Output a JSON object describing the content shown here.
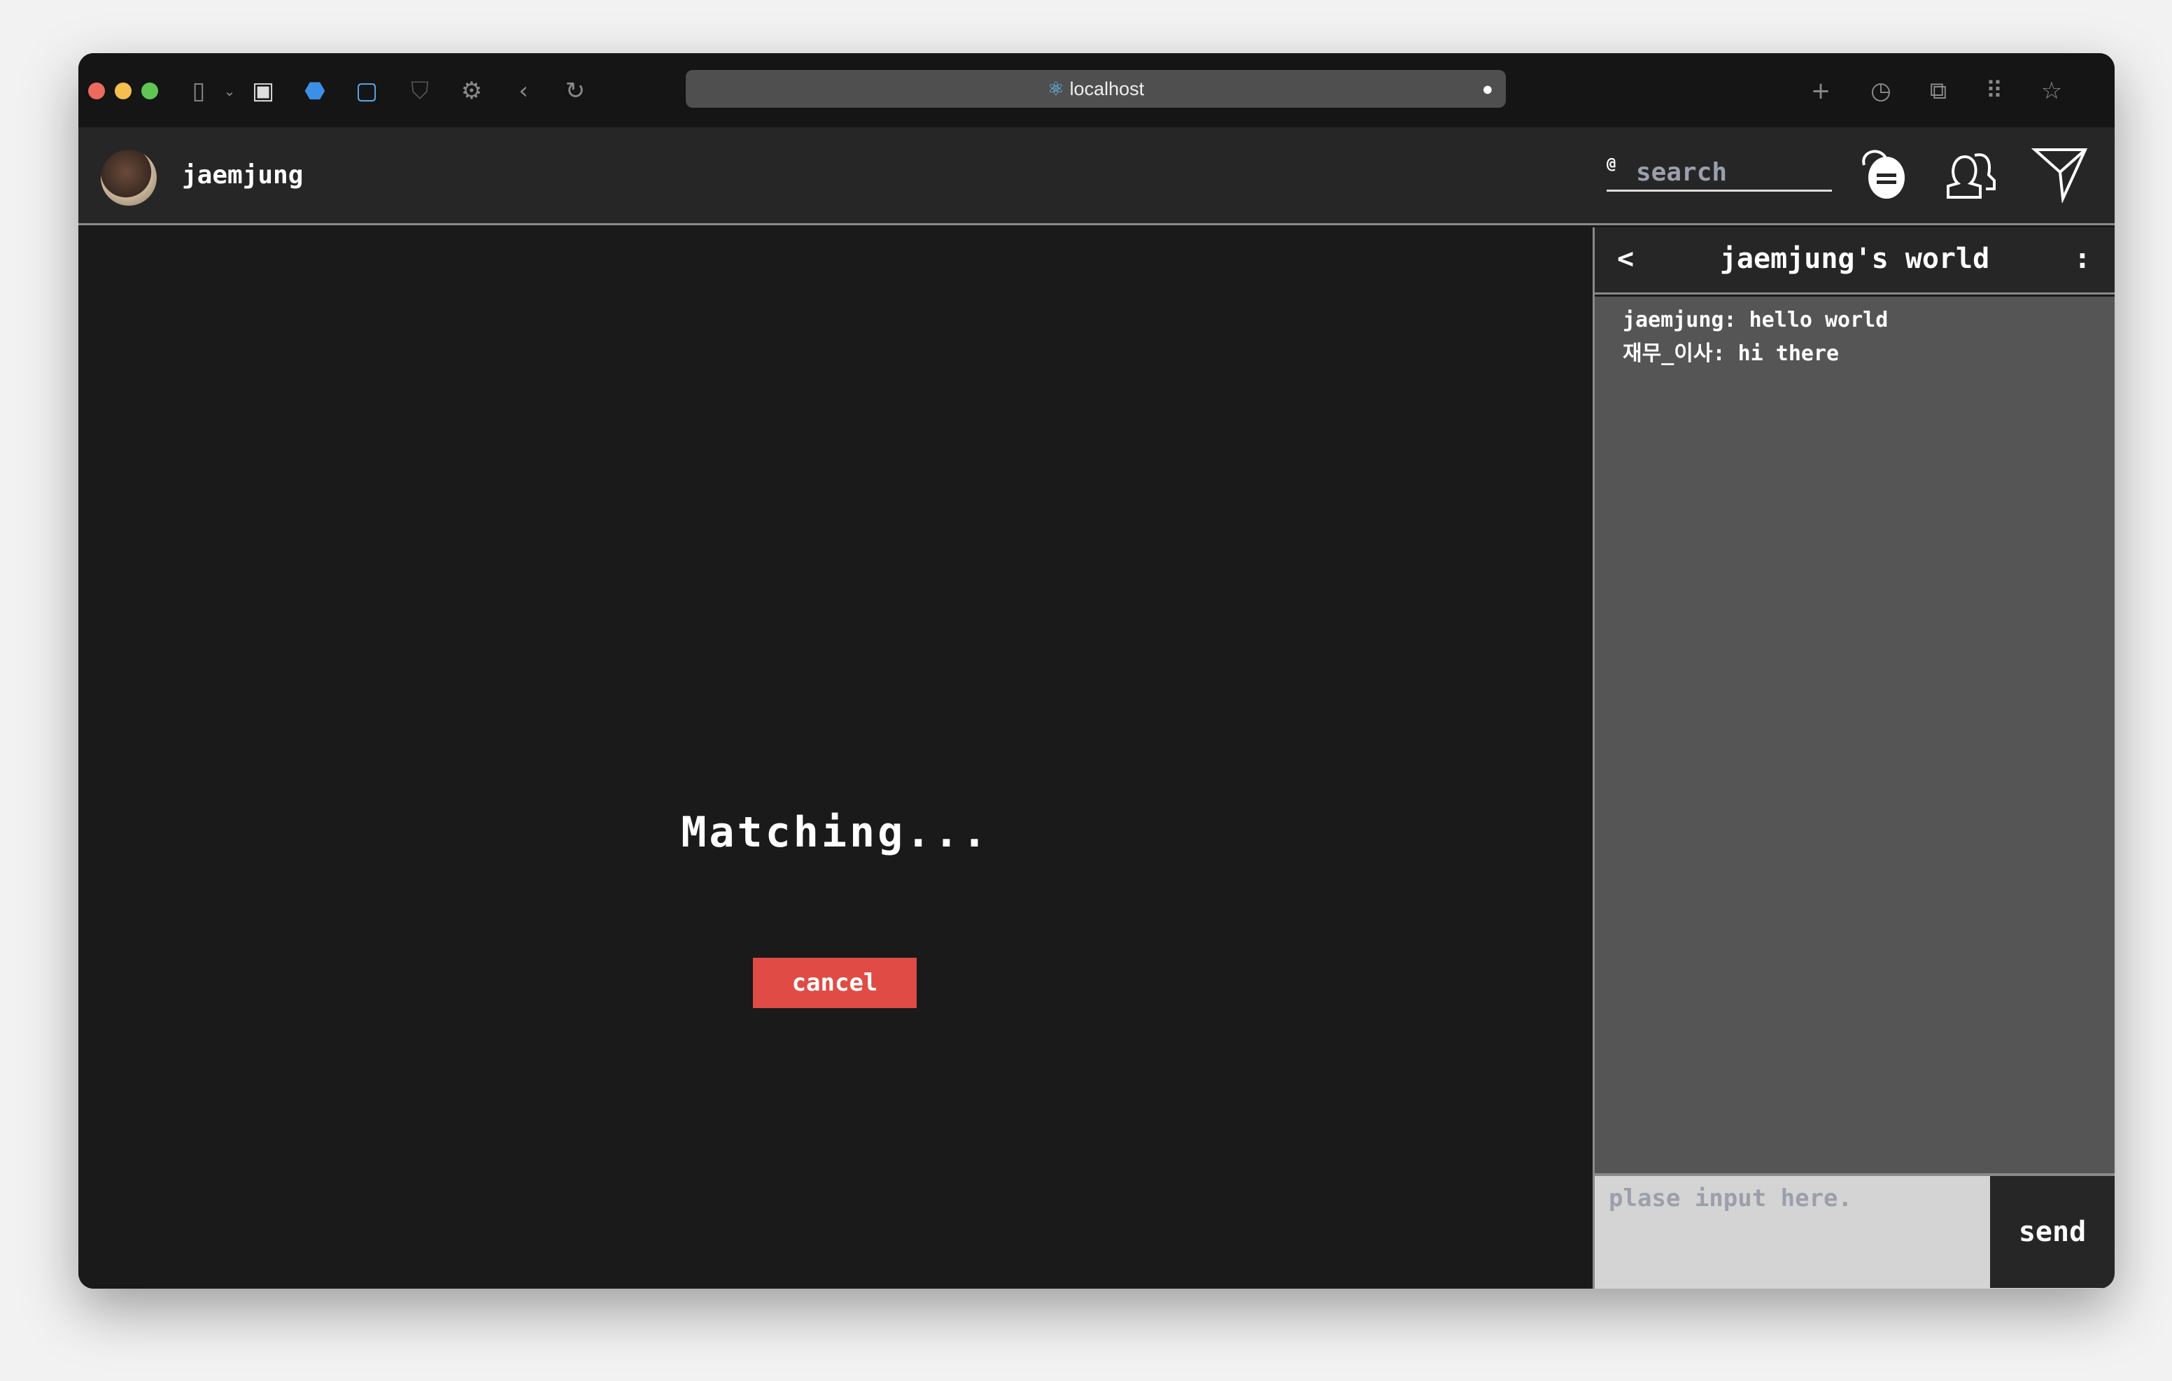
{
  "browser": {
    "url": "localhost",
    "colors": {
      "close": "#ec6a5e",
      "minimize": "#f4bf4f",
      "maximize": "#61c554"
    }
  },
  "header": {
    "username": "jaemjung",
    "search_prefix": "@",
    "search_placeholder": "search"
  },
  "main": {
    "status": "Matching...",
    "cancel_label": "cancel",
    "cancel_color": "#e04b45"
  },
  "chat": {
    "title": "jaemjung's world",
    "back": "<",
    "more": ":",
    "messages": [
      {
        "text": "jaemjung: hello world"
      },
      {
        "text": "재무_이사: hi there"
      }
    ],
    "input_placeholder": "plase input here.",
    "send_label": "send"
  }
}
